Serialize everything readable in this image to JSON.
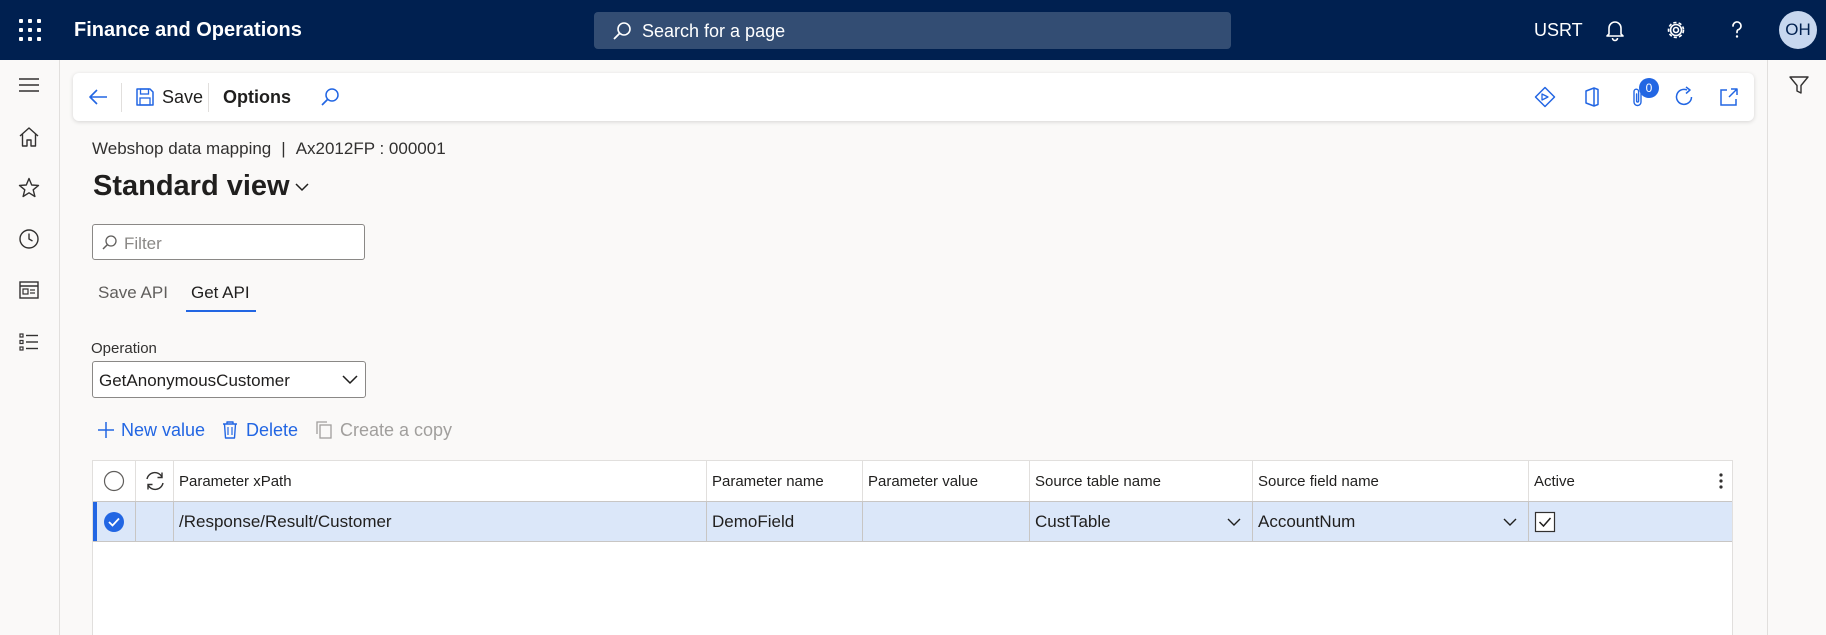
{
  "app": {
    "title": "Finance and Operations"
  },
  "search": {
    "label": "Search for a page"
  },
  "topbar": {
    "company": "USRT",
    "avatar_initials": "OH"
  },
  "actionpane": {
    "save_label": "Save",
    "options_label": "Options",
    "attachments_count": "0"
  },
  "breadcrumb": {
    "form": "Webshop data mapping",
    "separator": "|",
    "record": "Ax2012FP : 000001"
  },
  "page": {
    "view_title": "Standard view"
  },
  "filter": {
    "placeholder": "Filter"
  },
  "tabs": [
    {
      "label": "Save API",
      "active": false
    },
    {
      "label": "Get API",
      "active": true
    }
  ],
  "operation": {
    "label": "Operation",
    "value": "GetAnonymousCustomer"
  },
  "grid_actions": {
    "new_value": "New value",
    "delete": "Delete",
    "create_copy": "Create a copy"
  },
  "grid": {
    "columns": [
      "Parameter xPath",
      "Parameter name",
      "Parameter value",
      "Source table name",
      "Source field name",
      "Active"
    ],
    "rows": [
      {
        "selected": true,
        "parameter_xpath": "/Response/Result/Customer",
        "parameter_name": "DemoField",
        "parameter_value": "",
        "source_table_name": "CustTable",
        "source_field_name": "AccountNum",
        "active": true
      }
    ]
  },
  "colors": {
    "topbar": "#002050",
    "accent": "#2266e3",
    "row_selected": "#dbe7f9",
    "disabled_text": "#a19f9d"
  }
}
